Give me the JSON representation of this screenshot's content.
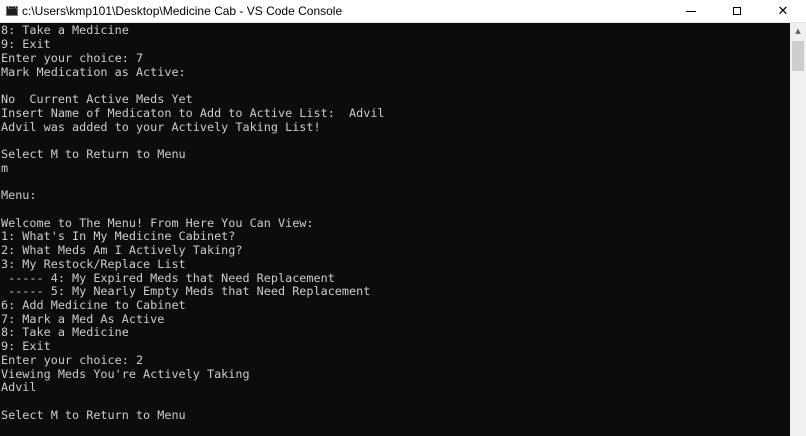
{
  "window": {
    "title": "c:\\Users\\kmp101\\Desktop\\Medicine Cab - VS Code Console",
    "minimize_icon": "minimize-icon",
    "maximize_icon": "maximize-icon",
    "close_icon": "close-icon",
    "close_glyph": "✕"
  },
  "console": {
    "lines": [
      "8: Take a Medicine",
      "9: Exit",
      "Enter your choice: 7",
      "Mark Medication as Active:",
      "",
      "No  Current Active Meds Yet",
      "Insert Name of Medicaton to Add to Active List:  Advil",
      "Advil was added to your Actively Taking List!",
      "",
      "Select M to Return to Menu",
      "m",
      "",
      "Menu:",
      "",
      "Welcome to The Menu! From Here You Can View:",
      "1: What's In My Medicine Cabinet?",
      "2: What Meds Am I Actively Taking?",
      "3: My Restock/Replace List",
      " ----- 4: My Expired Meds that Need Replacement",
      " ----- 5: My Nearly Empty Meds that Need Replacement",
      "6: Add Medicine to Cabinet",
      "7: Mark a Med As Active",
      "8: Take a Medicine",
      "9: Exit",
      "Enter your choice: 2",
      "Viewing Meds You're Actively Taking",
      "Advil",
      "",
      "Select M to Return to Menu"
    ]
  },
  "scrollbar": {
    "up_arrow": "▲"
  }
}
